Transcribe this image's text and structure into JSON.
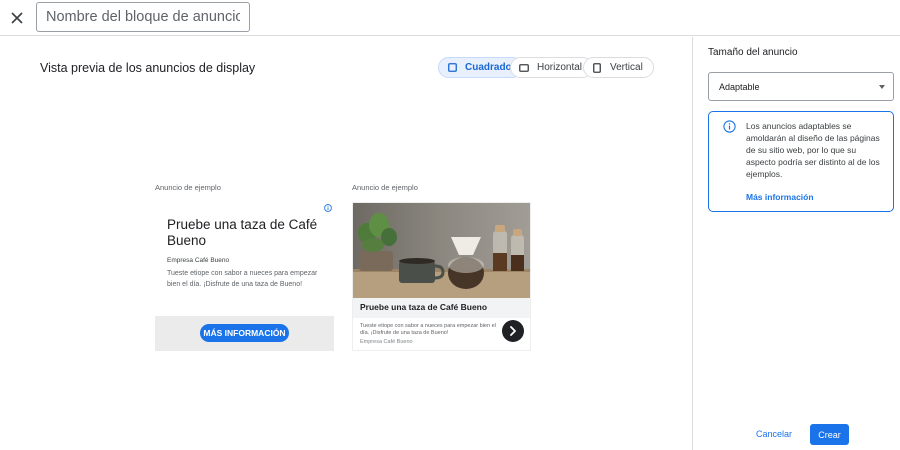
{
  "header": {
    "close_icon": "close-icon",
    "name_placeholder": "Nombre del bloque de anuncios"
  },
  "preview": {
    "title": "Vista previa de los anuncios de display",
    "toggles": [
      {
        "label": "Cuadrado",
        "selected": true
      },
      {
        "label": "Horizontal",
        "selected": false
      },
      {
        "label": "Vertical",
        "selected": false
      }
    ],
    "examples": [
      {
        "label": "Anuncio de ejemplo",
        "headline": "Pruebe una taza de Café Bueno",
        "company": "Empresa Café Bueno",
        "description": "Tueste etiope con sabor a nueces para empezar bien el día. ¡Disfrute de una taza de Bueno!",
        "cta": "MÁS INFORMACIÓN"
      },
      {
        "label": "Anuncio de ejemplo",
        "headline": "Pruebe una taza de Café Bueno",
        "description": "Tueste etiope con sabor a nueces para empezar bien el día. ¡Disfrute de una taza de Bueno!",
        "company": "Empresa Café Bueno"
      }
    ]
  },
  "panel": {
    "title": "Tamaño del anuncio",
    "select_value": "Adaptable",
    "info_text": "Los anuncios adaptables se amoldarán al diseño de las páginas de su sitio web, por lo que su aspecto podría ser distinto al de los ejemplos.",
    "info_link": "Más información"
  },
  "footer": {
    "cancel": "Cancelar",
    "create": "Crear"
  },
  "colors": {
    "accent": "#1a73e8",
    "selected_toggle_bg": "#e8f0fe"
  }
}
